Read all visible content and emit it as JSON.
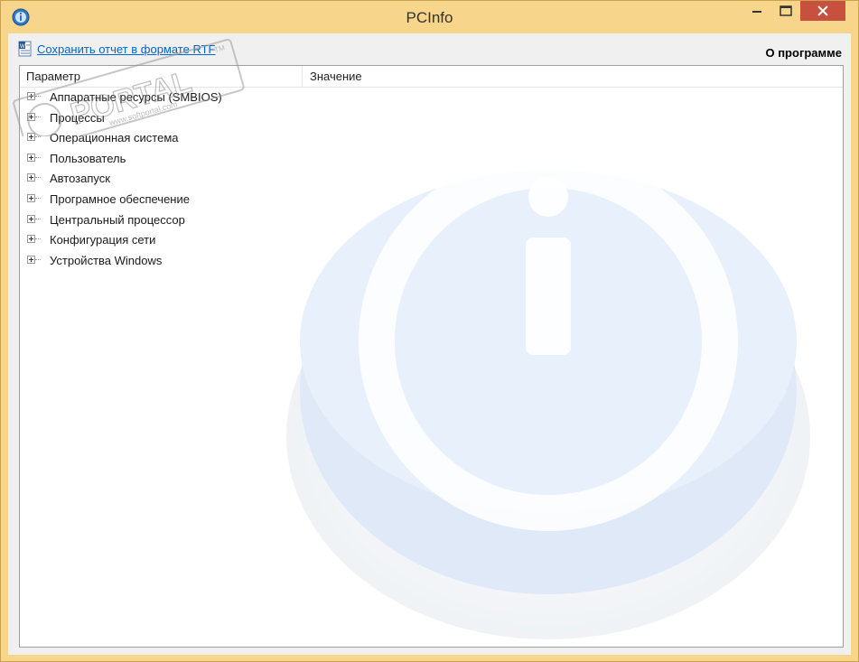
{
  "window": {
    "title": "PCInfo"
  },
  "toolbar": {
    "save_report_label": "Сохранить отчет в формате RTF",
    "about_label": "О программе"
  },
  "tree": {
    "columns": [
      "Параметр",
      "Значение"
    ],
    "items": [
      {
        "label": "Аппаратные ресурсы (SMBIOS)"
      },
      {
        "label": "Процессы"
      },
      {
        "label": "Операционная система"
      },
      {
        "label": "Пользователь"
      },
      {
        "label": "Автозапуск"
      },
      {
        "label": "Програмное обеспечение"
      },
      {
        "label": "Центральный процессор"
      },
      {
        "label": "Конфигурация сети"
      },
      {
        "label": "Устройства Windows"
      }
    ]
  },
  "watermark_stamp": {
    "brand": "PORTAL",
    "url": "www.softportal.com",
    "tm": "TM"
  },
  "colors": {
    "frame": "#f7d58a",
    "close_button": "#c7503e",
    "link": "#0066cc",
    "watermark": "#dde9f8"
  },
  "icons": {
    "app": "info-app-icon",
    "save": "rtf-document-icon",
    "expander": "plus-expander-icon",
    "watermark": "info-button-icon"
  }
}
